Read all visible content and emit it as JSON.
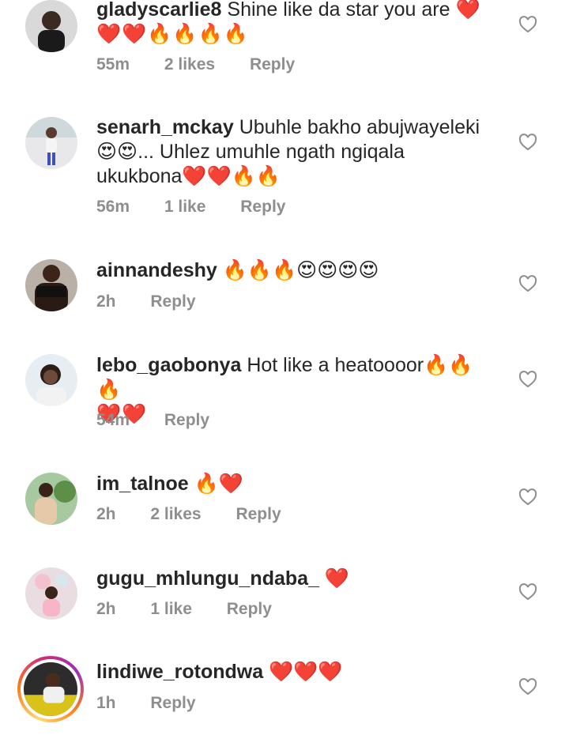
{
  "comments": [
    {
      "username": "gladyscarlie8",
      "text": "Shine like da star you are ❤️",
      "text2": "❤️❤️🔥🔥🔥🔥",
      "time": "55m",
      "likes": "2 likes",
      "reply": "Reply"
    },
    {
      "username": "senarh_mckay",
      "text": "Ubuhle bakho abujwayeleki",
      "text2": "😍😍... Uhlez umuhle ngath ngiqala",
      "text3": "ukukbona❤️❤️🔥🔥",
      "time": "56m",
      "likes": "1 like",
      "reply": "Reply"
    },
    {
      "username": "ainnandeshy",
      "text": "🔥🔥🔥😍😍😍😍",
      "time": "2h",
      "reply": "Reply"
    },
    {
      "username": "lebo_gaobonya",
      "text": "Hot like a heatoooor🔥🔥🔥",
      "text2": "❤️❤️",
      "time": "54m",
      "reply": "Reply"
    },
    {
      "username": "im_talnoe",
      "text": "🔥❤️",
      "time": "2h",
      "likes": "2 likes",
      "reply": "Reply"
    },
    {
      "username": "gugu_mhlungu_ndaba_",
      "text": "❤️",
      "time": "2h",
      "likes": "1 like",
      "reply": "Reply"
    },
    {
      "username": "lindiwe_rotondwa",
      "text": "❤️❤️❤️",
      "time": "1h",
      "reply": "Reply"
    }
  ],
  "colors": {
    "text": "#262626",
    "meta": "#8e8e8e",
    "icon": "#8e8e8e"
  },
  "icons": {
    "like": "heart-outline-icon"
  }
}
